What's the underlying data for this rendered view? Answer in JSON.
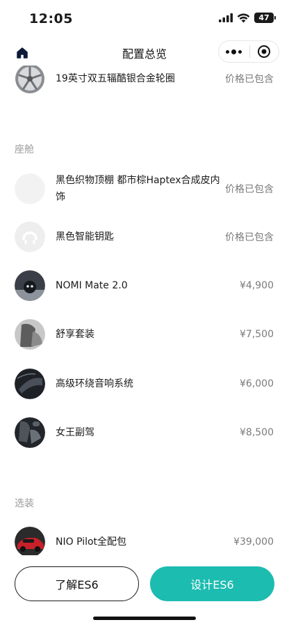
{
  "status_bar": {
    "time": "12:05",
    "battery": "47"
  },
  "nav": {
    "title": "配置总览"
  },
  "wheel_item": {
    "name": "19英寸双五辐酷银合金轮圈",
    "price": "价格已包含"
  },
  "sections": [
    {
      "label": "座舱",
      "items": [
        {
          "name": "黑色织物顶棚 都市棕Haptex合成皮内饰",
          "price": "价格已包含",
          "thumb": "fabric-swatch-icon"
        },
        {
          "name": "黑色智能钥匙",
          "price": "价格已包含",
          "thumb": "nio-key-icon"
        },
        {
          "name": "NOMI Mate 2.0",
          "price": "¥4,900",
          "thumb": "nomi-robot-icon"
        },
        {
          "name": "舒享套装",
          "price": "¥7,500",
          "thumb": "seat-icon"
        },
        {
          "name": "高级环绕音响系统",
          "price": "¥6,000",
          "thumb": "speaker-icon"
        },
        {
          "name": "女王副驾",
          "price": "¥8,500",
          "thumb": "passenger-seat-icon"
        }
      ]
    },
    {
      "label": "选装",
      "items": [
        {
          "name": "NIO Pilot全配包",
          "price": "¥39,000",
          "thumb": "red-car-icon"
        }
      ]
    }
  ],
  "actions": {
    "learn_label": "了解ES6",
    "design_label": "设计ES6"
  },
  "colors": {
    "accent": "#1cbcb0",
    "text": "#1a1a1a",
    "muted": "#7a7a7a",
    "section": "#9a9a9a"
  }
}
